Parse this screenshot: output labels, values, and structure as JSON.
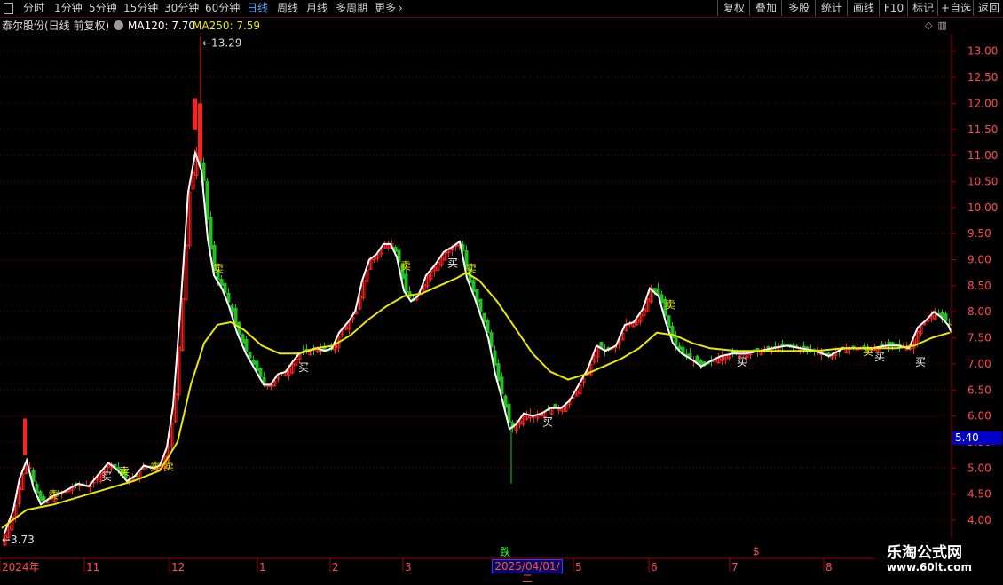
{
  "toolbar": {
    "tabs": [
      {
        "label": "分时",
        "active": false
      },
      {
        "label": "1分钟",
        "active": false
      },
      {
        "label": "5分钟",
        "active": false
      },
      {
        "label": "15分钟",
        "active": false
      },
      {
        "label": "30分钟",
        "active": false
      },
      {
        "label": "60分钟",
        "active": false
      },
      {
        "label": "日线",
        "active": true
      },
      {
        "label": "周线",
        "active": false
      },
      {
        "label": "月线",
        "active": false
      },
      {
        "label": "多周期",
        "active": false
      },
      {
        "label": "更多",
        "active": false
      }
    ],
    "right_buttons": [
      "复权",
      "叠加",
      "多股",
      "统计",
      "画线",
      "F10",
      "标记",
      "+自选",
      "返回"
    ]
  },
  "info": {
    "stock_name": "泰尔股份(日线 前复权)",
    "ma120_label": "MA120: 7.70",
    "ma250_label": "MA250: 7.59"
  },
  "colors": {
    "up": "#ff2020",
    "down": "#22c022",
    "ma_short": "#ffffff",
    "ma_long": "#e8e800",
    "axis": "#a00000",
    "grid": "#6a0000",
    "label": "#ff4a4a"
  },
  "chart_data": {
    "type": "candlestick",
    "ylim": [
      3.5,
      13.5
    ],
    "y_ticks": [
      "13.00",
      "12.50",
      "12.00",
      "11.50",
      "11.00",
      "10.50",
      "10.00",
      "9.50",
      "9.00",
      "8.50",
      "8.00",
      "7.50",
      "7.00",
      "6.50",
      "6.00",
      "5.50",
      "5.00",
      "4.50",
      "4.00"
    ],
    "x_labels": [
      "2024年",
      "11",
      "12",
      "1",
      "2",
      "3",
      "5",
      "6",
      "7",
      "8"
    ],
    "annotations": {
      "high": "13.29",
      "low": "3.73",
      "signal_buy": "买",
      "signal_sell": "卖",
      "fall_label": "跌"
    },
    "price_tag": "5.40",
    "selected_date": "2025/04/01/二",
    "dollar_mark": "$"
  },
  "watermark": {
    "line1": "乐淘公式网",
    "line2": "www.60lt.com"
  }
}
